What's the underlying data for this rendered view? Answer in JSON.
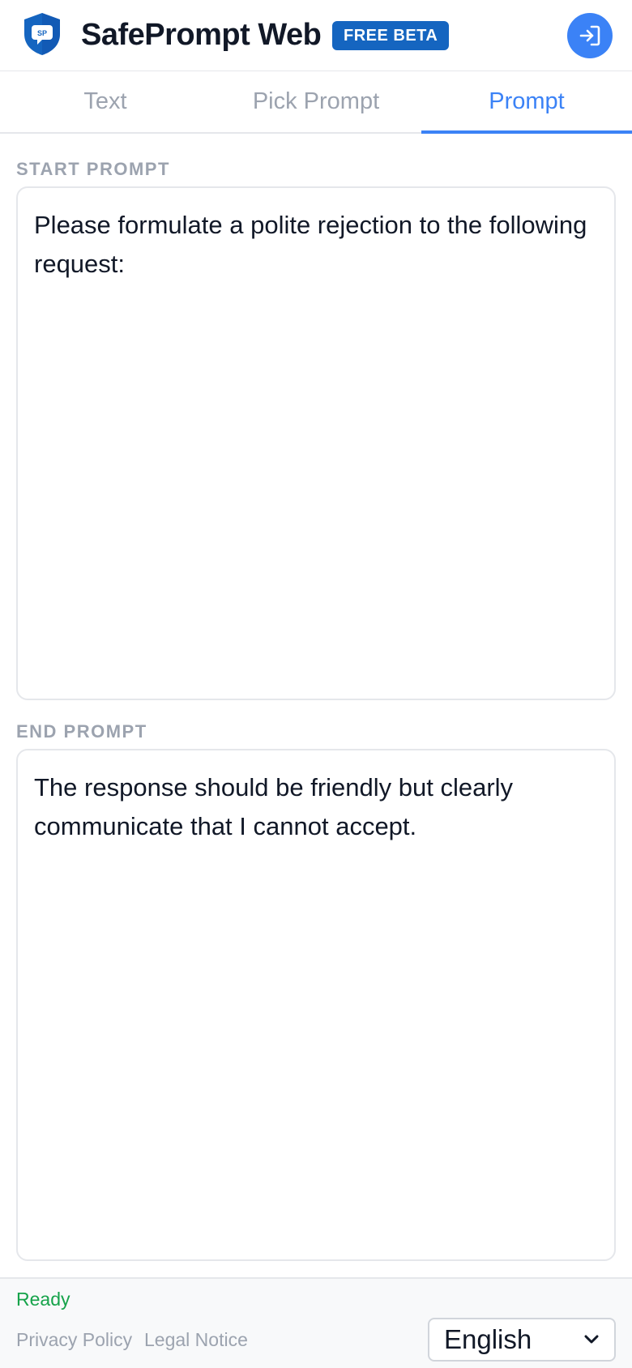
{
  "header": {
    "logo_text": "SP",
    "title": "SafePrompt Web",
    "badge": "FREE BETA",
    "login_icon": "login-arrow-icon"
  },
  "tabs": [
    {
      "label": "Text",
      "active": false
    },
    {
      "label": "Pick Prompt",
      "active": false
    },
    {
      "label": "Prompt",
      "active": true
    }
  ],
  "start_prompt": {
    "label": "START PROMPT",
    "value": "Please formulate a polite rejection to the following request:"
  },
  "end_prompt": {
    "label": "END PROMPT",
    "value": "The response should be friendly but clearly communicate that I cannot accept."
  },
  "footer": {
    "status": "Ready",
    "privacy_link": "Privacy Policy",
    "legal_link": "Legal Notice",
    "language": "English",
    "language_icon": "chevron-down-icon"
  },
  "colors": {
    "accent": "#3b82f6",
    "badge": "#1565c0",
    "status_ok": "#16a34a",
    "muted": "#9ca3af"
  }
}
